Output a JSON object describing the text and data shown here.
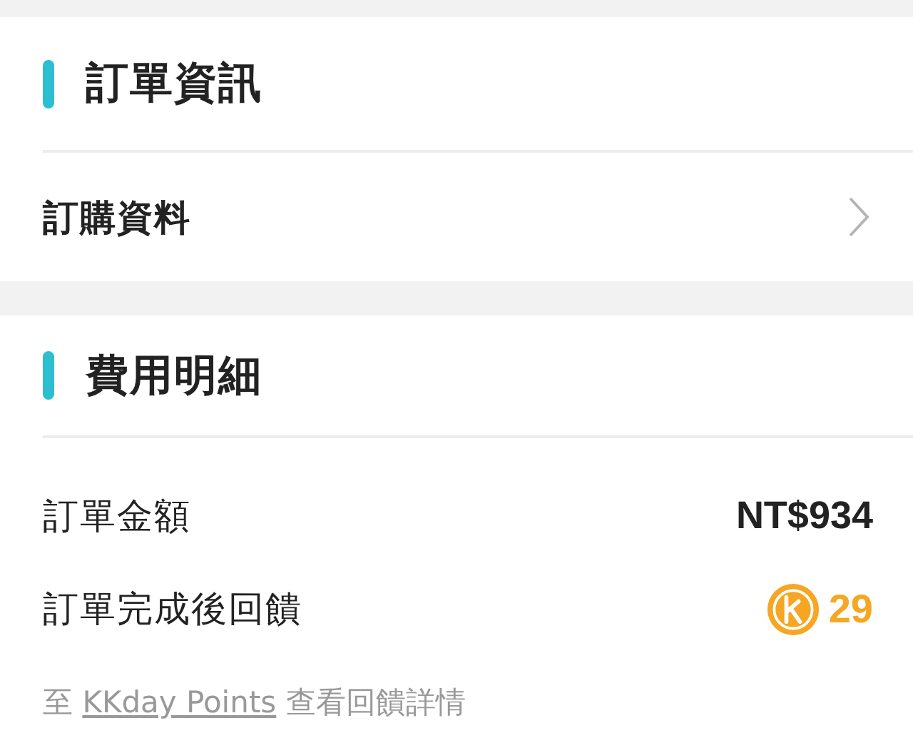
{
  "sections": [
    {
      "title": "訂單資訊",
      "rows": [
        {
          "kind": "link",
          "label": "訂購資料"
        }
      ]
    },
    {
      "title": "費用明細",
      "rows": [
        {
          "kind": "amount",
          "label": "訂單金額",
          "value": "NT$934"
        },
        {
          "kind": "points",
          "label": "訂單完成後回饋",
          "value": "29"
        }
      ],
      "note": {
        "prefix": "至",
        "link": "KKday Points",
        "suffix": "查看回饋詳情"
      }
    }
  ]
}
